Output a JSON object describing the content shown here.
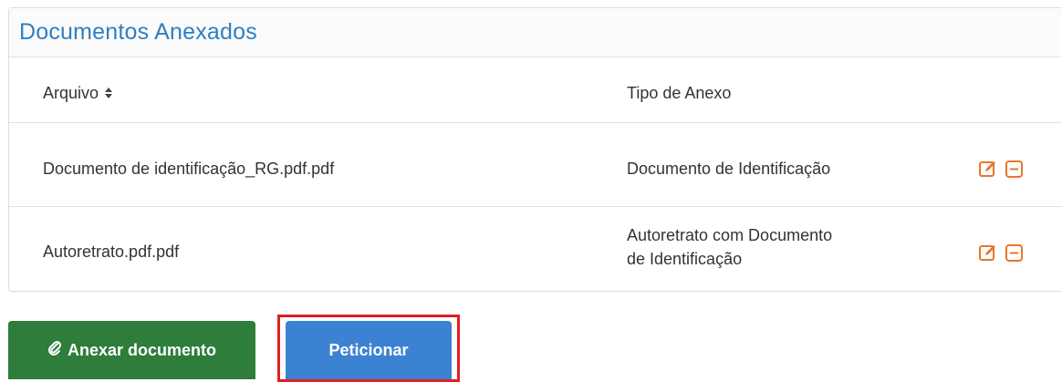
{
  "panel": {
    "title": "Documentos Anexados"
  },
  "table": {
    "headers": {
      "file": "Arquivo",
      "type": "Tipo de Anexo"
    },
    "rows": [
      {
        "file": "Documento de identificação_RG.pdf.pdf",
        "type_line1": "Documento de Identificação",
        "type_line2": ""
      },
      {
        "file": "Autoretrato.pdf.pdf",
        "type_line1": "Autoretrato com Documento",
        "type_line2": "de Identificação"
      }
    ]
  },
  "icons": {
    "sort": "sort-icon",
    "edit": "edit-icon",
    "remove": "remove-icon",
    "attach": "paperclip-icon"
  },
  "buttons": {
    "attach_label": "Anexar documento",
    "submit_label": "Peticionar"
  },
  "colors": {
    "title": "#2f7fc2",
    "action_icons": "#e8762b",
    "attach_button": "#2e7d3a",
    "submit_button": "#3c82d2",
    "highlight": "#e31d23"
  }
}
